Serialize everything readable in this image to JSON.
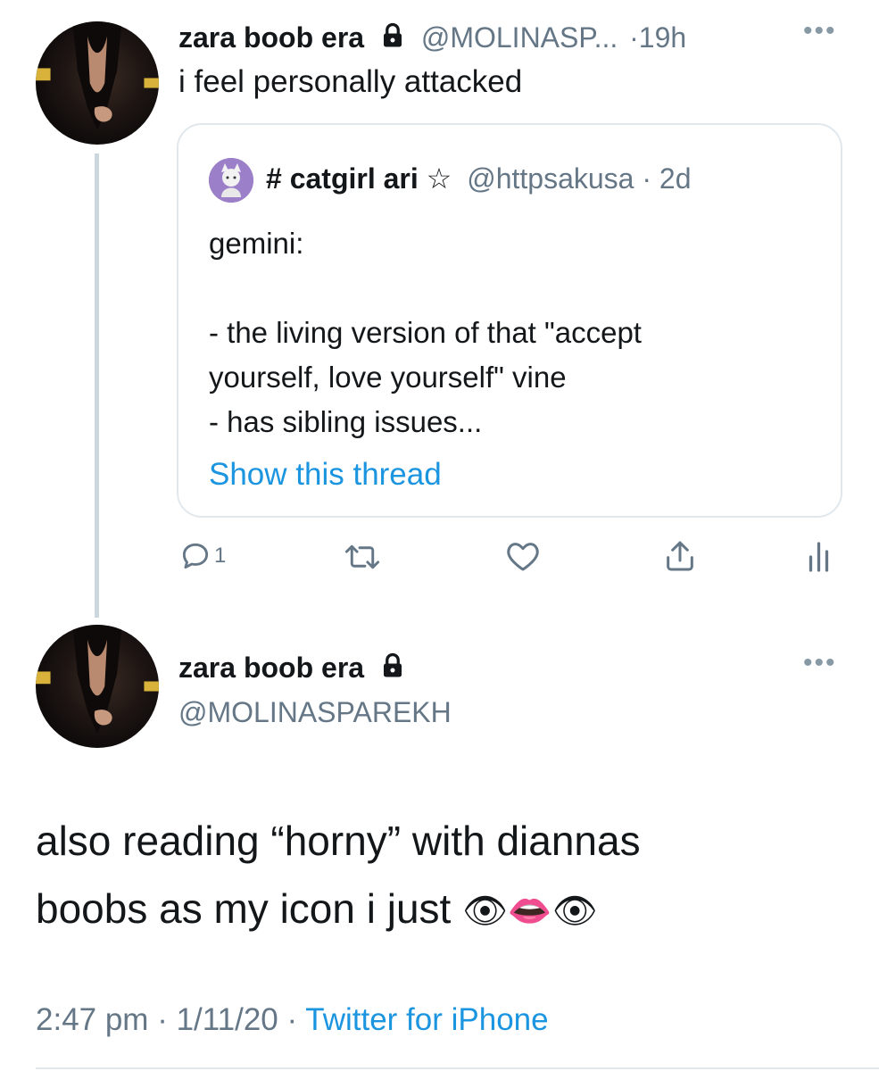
{
  "tweet1": {
    "display_name": "zara boob era",
    "handle": "@MOLINASP...",
    "separator": "·",
    "time": "19h",
    "text": "i feel personally attacked",
    "more_icon": "more-horizontal-icon",
    "lock_icon": "lock-icon"
  },
  "quote": {
    "display_name": "# catgirl ari ☆",
    "handle": "@httpsakusa",
    "separator": "·",
    "time": "2d",
    "lines": [
      "gemini:",
      "- the living version of that \"accept",
      "yourself, love yourself\" vine",
      "- has sibling issues..."
    ],
    "show_thread": "Show this thread"
  },
  "actions": {
    "reply_count": "1",
    "icons": [
      "reply-icon",
      "retweet-icon",
      "like-icon",
      "share-icon",
      "analytics-icon"
    ]
  },
  "tweet2": {
    "display_name": "zara boob era",
    "handle": "@MOLINASPAREKH",
    "text_line1": "also reading “horny” with diannas",
    "text_line2": "boobs as my icon i just",
    "emoji": "👁👄👁",
    "time": "2:47 pm",
    "sep1": "·",
    "date": "1/11/20",
    "sep2": "·",
    "source": "Twitter for iPhone"
  },
  "colors": {
    "link": "#1b95e0",
    "secondary": "#657786",
    "border": "#e1e8ed",
    "thread_line": "#ccd6dd"
  }
}
